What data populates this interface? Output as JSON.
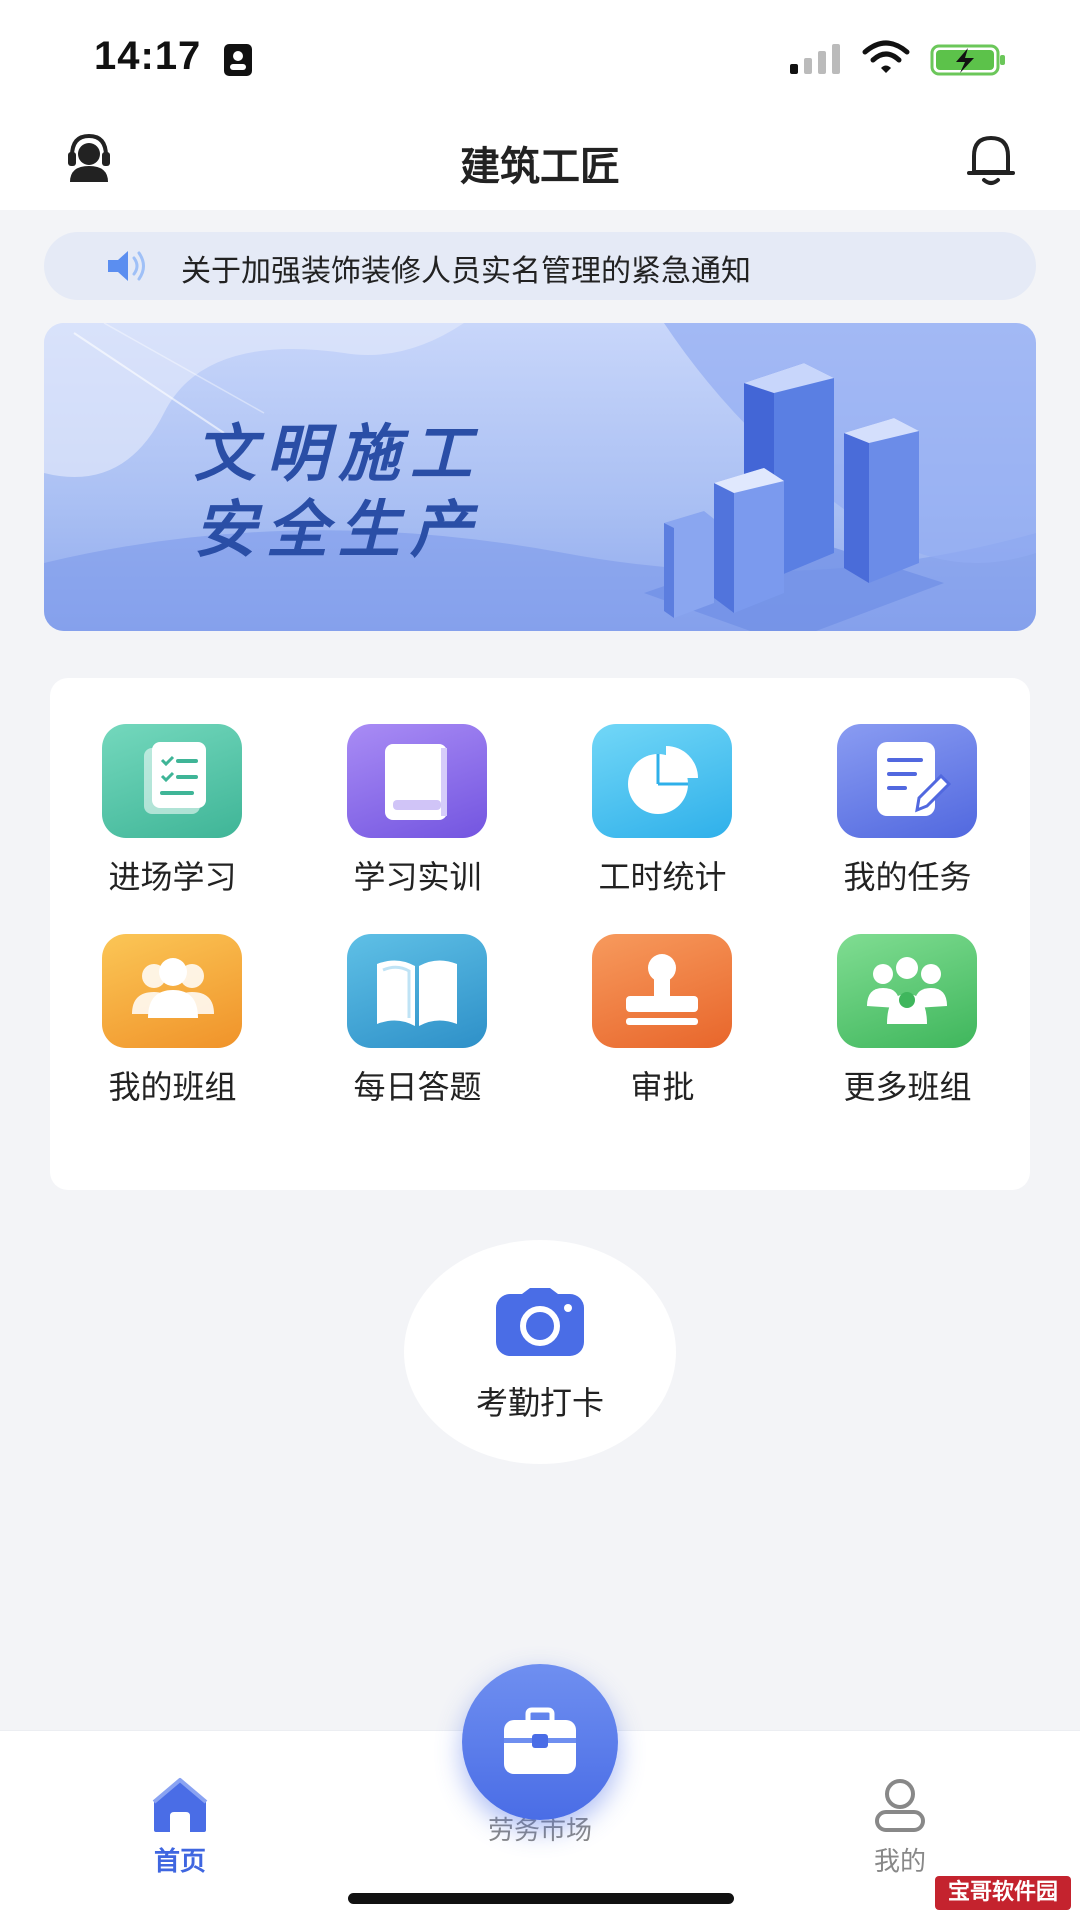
{
  "status_bar": {
    "time": "14:17"
  },
  "nav": {
    "title": "建筑工匠"
  },
  "notice": {
    "text": "关于加强装饰装修人员实名管理的紧急通知"
  },
  "banner": {
    "line1": "文明施工",
    "line2": "安全生产"
  },
  "grid": {
    "items": [
      {
        "label": "进场学习",
        "icon": "checklist-doc-icon",
        "color": "#4fc2a6"
      },
      {
        "label": "学习实训",
        "icon": "book-icon",
        "color": "#8a6bea"
      },
      {
        "label": "工时统计",
        "icon": "pie-chart-icon",
        "color": "#45c1ee"
      },
      {
        "label": "我的任务",
        "icon": "edit-note-icon",
        "color": "#6176e6"
      },
      {
        "label": "我的班组",
        "icon": "team-icon",
        "color": "#f5a631"
      },
      {
        "label": "每日答题",
        "icon": "open-book-icon",
        "color": "#3ea6d4"
      },
      {
        "label": "审批",
        "icon": "stamp-icon",
        "color": "#f07a3d"
      },
      {
        "label": "更多班组",
        "icon": "group-icon",
        "color": "#5ccb74"
      }
    ]
  },
  "checkin": {
    "label": "考勤打卡"
  },
  "tabbar": {
    "home": "首页",
    "market": "劳务市场",
    "mine": "我的"
  },
  "watermark": "宝哥软件园",
  "colors": {
    "accent": "#3f66e0",
    "background": "#f3f4f7"
  }
}
